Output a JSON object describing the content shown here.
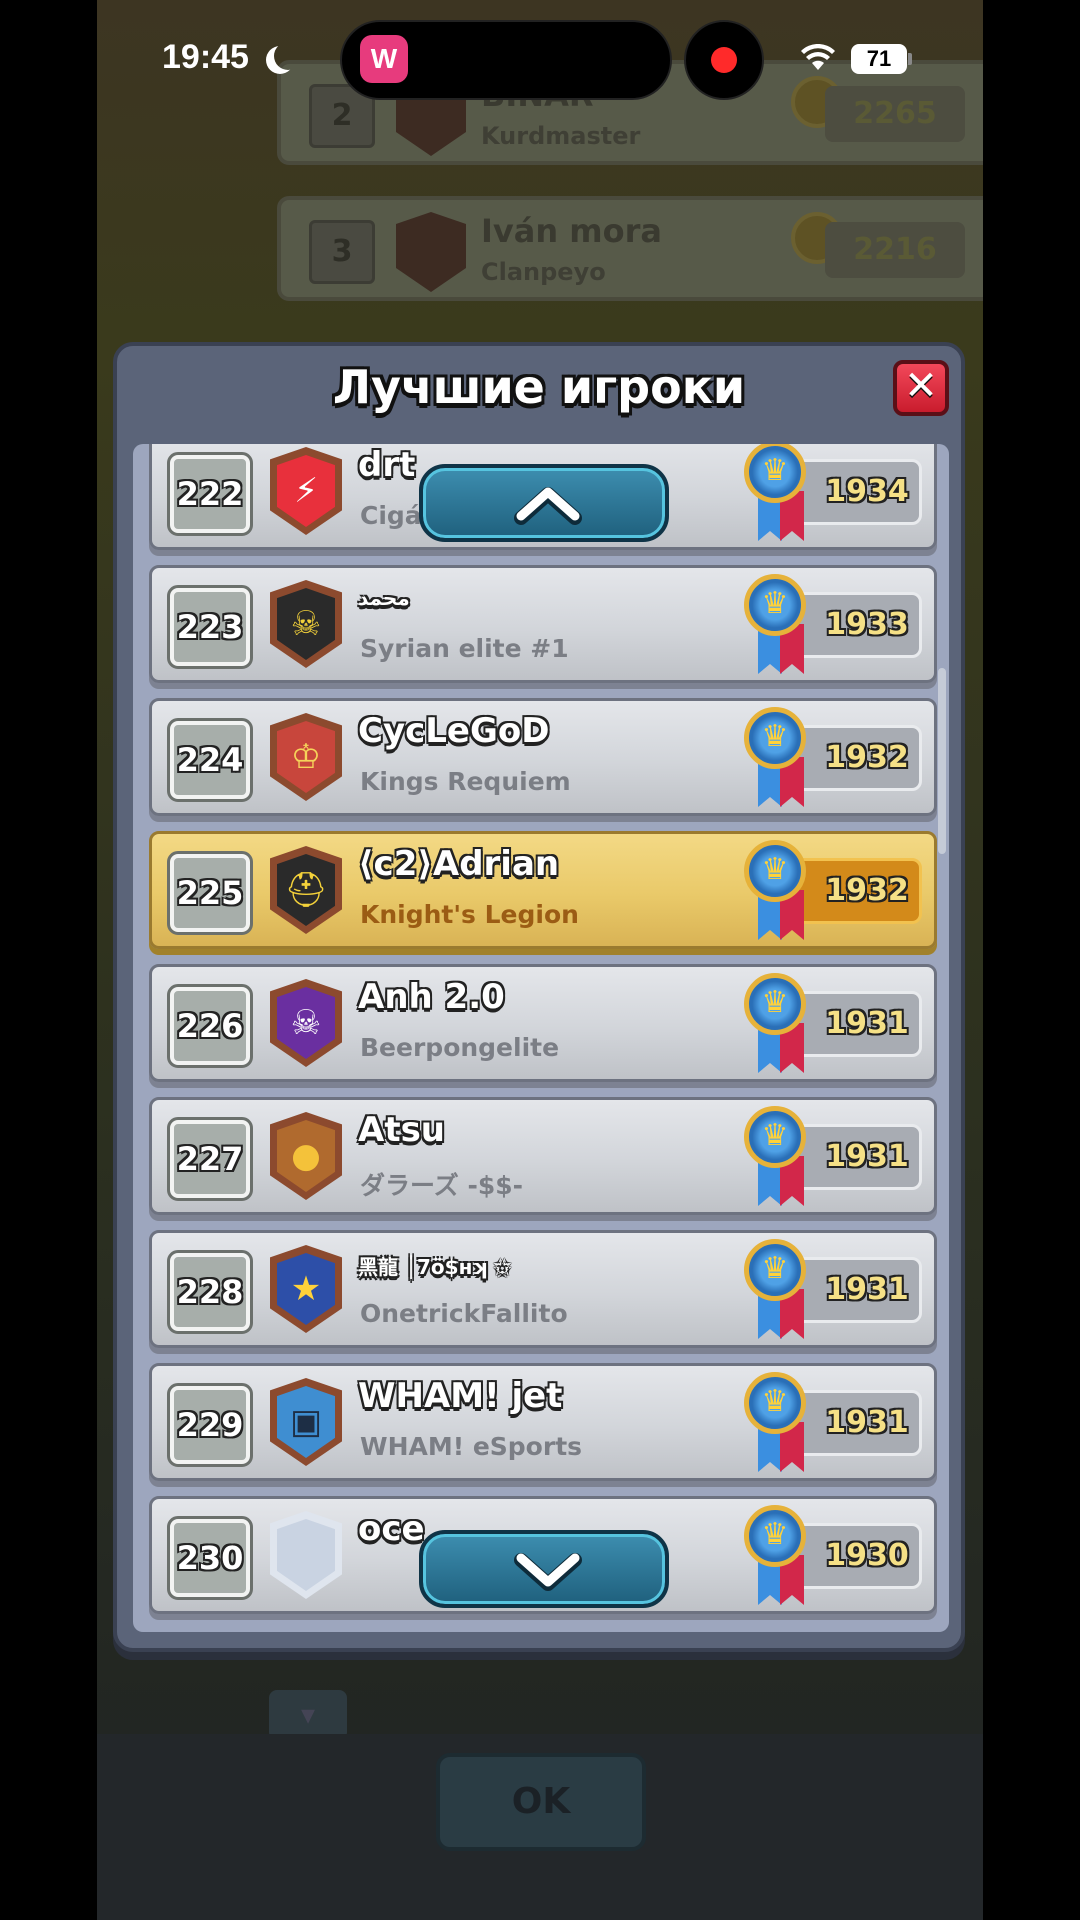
{
  "status_bar": {
    "time": "19:45",
    "island_app_letter": "W",
    "battery_level": "71"
  },
  "background": {
    "rows": [
      {
        "rank": "2",
        "name": "BINAR",
        "clan": "Kurdmaster",
        "trophies": "2265"
      },
      {
        "rank": "3",
        "name": "Iván mora",
        "clan": "Clanpeyo",
        "trophies": "2216"
      }
    ],
    "ok_label": "OK"
  },
  "dialog": {
    "title": "Лучшие игроки",
    "close_label": "✕",
    "rows": [
      {
        "rank": "222",
        "name": "drt",
        "clan": "Cigá",
        "trophies": "1934",
        "badge_icon": "lightning-icon",
        "badge_color": "#e8303c"
      },
      {
        "rank": "223",
        "name": "محمد",
        "clan": "Syrian elite #1",
        "trophies": "1933",
        "badge_icon": "skull-icon",
        "badge_color": "#2a2a2a"
      },
      {
        "rank": "224",
        "name": "CycLeGoD",
        "clan": "Kings Requiem",
        "trophies": "1932",
        "badge_icon": "king-face-icon",
        "badge_color": "#c8463c"
      },
      {
        "rank": "225",
        "name": "⟨c2⟩Adrian",
        "clan": "Knight's Legion",
        "trophies": "1932",
        "badge_icon": "knight-helmet-icon",
        "badge_color": "#2a2a2a",
        "highlight": true
      },
      {
        "rank": "226",
        "name": "Anh 2.0",
        "clan": "Beerpongelite",
        "trophies": "1931",
        "badge_icon": "purple-skull-icon",
        "badge_color": "#6a2fa0"
      },
      {
        "rank": "227",
        "name": "Atsu",
        "clan": "ダラーズ -$$-",
        "trophies": "1931",
        "badge_icon": "gold-coin-icon",
        "badge_color": "#b06a2e"
      },
      {
        "rank": "228",
        "name": "黑龍 │7ö$нʞ ✩",
        "clan": "OnetrickFallito",
        "trophies": "1931",
        "badge_icon": "star-icon",
        "badge_color": "#2d4fa8"
      },
      {
        "rank": "229",
        "name": "WHAM! jet",
        "clan": "WHAM! eSports",
        "trophies": "1931",
        "badge_icon": "helmet-icon",
        "badge_color": "#3f8ed1"
      },
      {
        "rank": "230",
        "name": "oce",
        "clan": "",
        "trophies": "1930",
        "badge_icon": "empty-shield-icon",
        "badge_color": "#c9d3e2"
      }
    ]
  }
}
